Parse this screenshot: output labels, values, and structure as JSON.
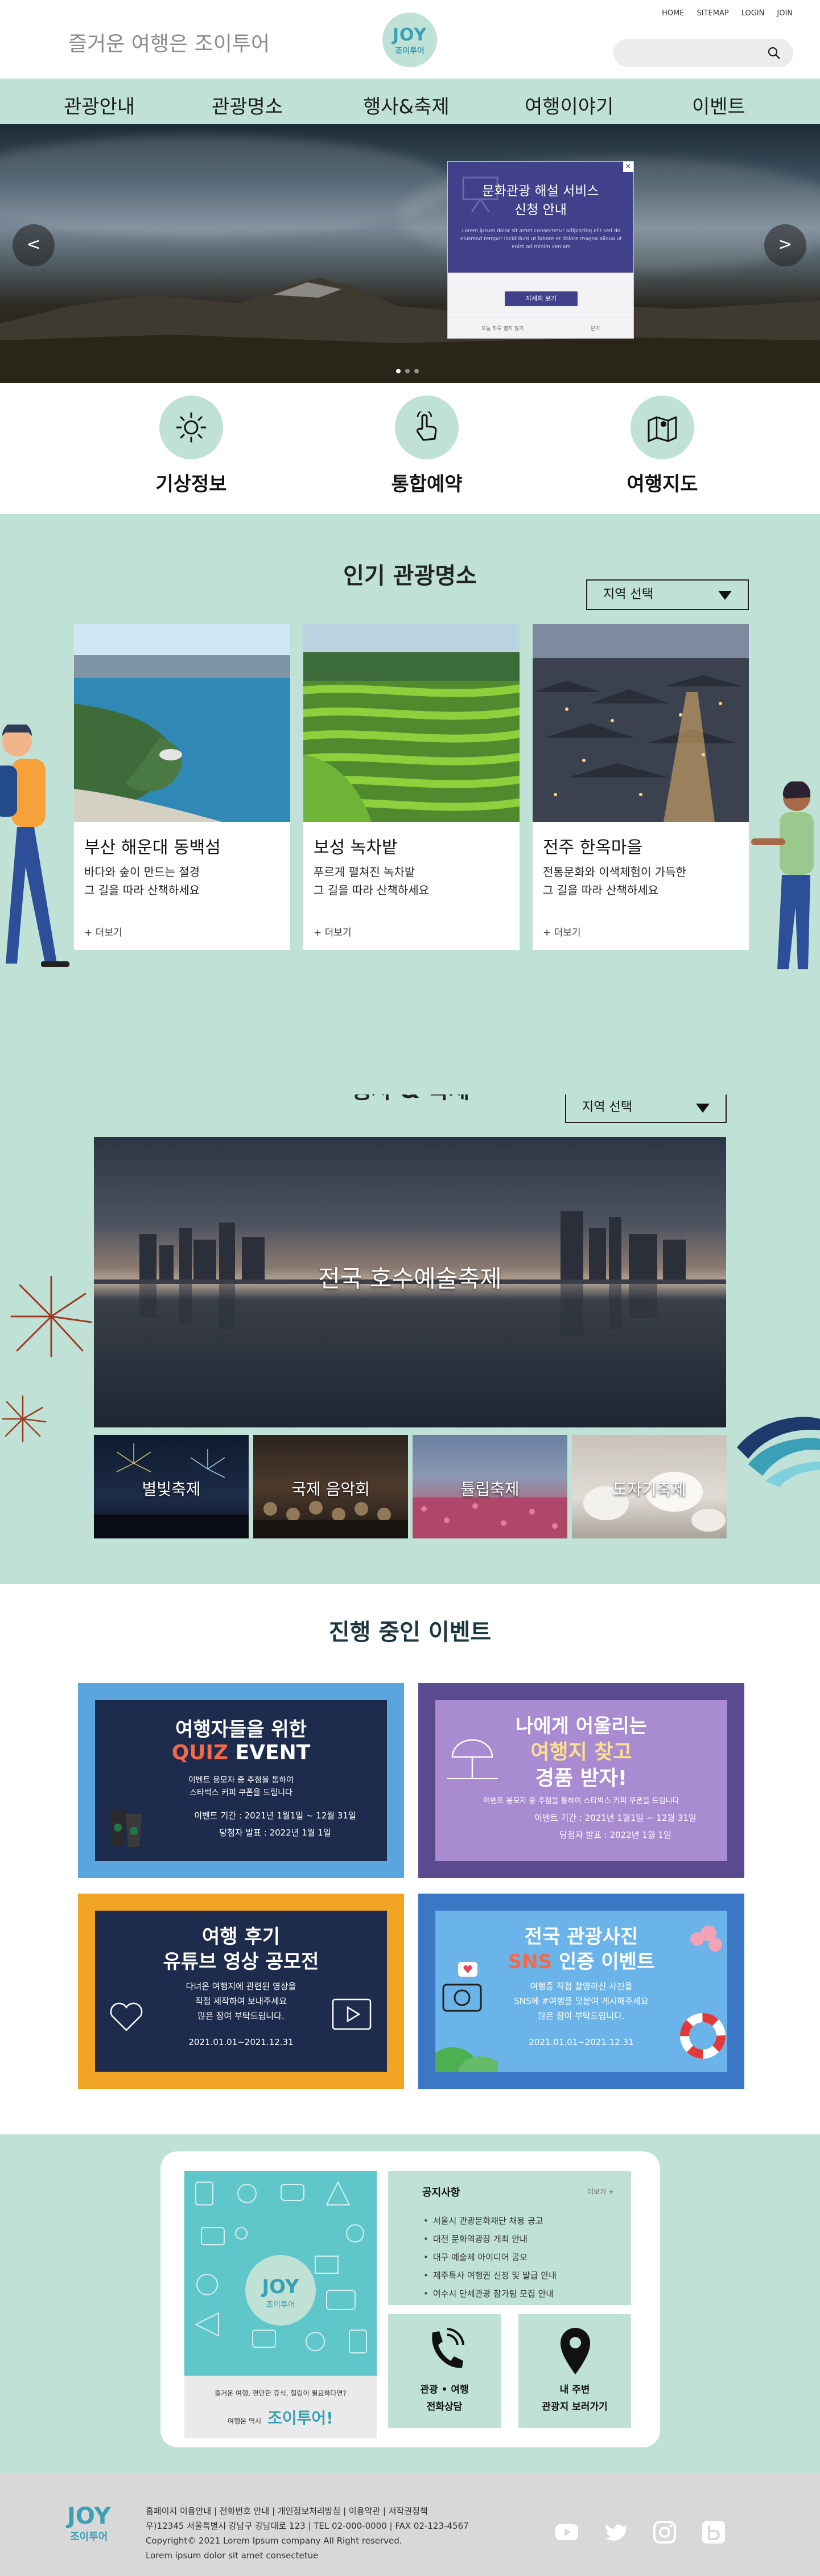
{
  "header": {
    "slogan": "즐거운 여행은 조이투어",
    "logo": {
      "word": "JOY",
      "sub": "조이투어"
    },
    "top_links": [
      "HOME",
      "SITEMAP",
      "LOGIN",
      "JOIN"
    ],
    "search_placeholder": ""
  },
  "nav": {
    "items": [
      "관광안내",
      "관광명소",
      "행사&축제",
      "여행이야기",
      "이벤트"
    ]
  },
  "hero": {
    "prev": "<",
    "next": ">",
    "popup": {
      "close": "×",
      "title_line1": "문화관광 해설 서비스",
      "title_line2": "신청 안내",
      "text": "Lorem ipsum dolor sit amet consectetur adipiscing elit sed do eiusmod tempor incididunt ut labore et dolore magna aliqua ut enim ad minim veniam",
      "button": "자세히 보기",
      "footer_left": "오늘 하루 열지 않기",
      "footer_right": "닫기"
    }
  },
  "quick": [
    {
      "label": "기상정보",
      "icon": "sun-icon"
    },
    {
      "label": "통합예약",
      "icon": "touch-hand-icon"
    },
    {
      "label": "여행지도",
      "icon": "map-pin-icon"
    }
  ],
  "attractions": {
    "title": "인기 관광명소",
    "region_select": "지역 선택",
    "cards": [
      {
        "title": "부산 해운대 동백섬",
        "desc1": "바다와 숲이 만드는 절경",
        "desc2": "그 길을 따라 산책하세요",
        "more": "+ 더보기"
      },
      {
        "title": "보성 녹차밭",
        "desc1": "푸르게 펼쳐진 녹차밭",
        "desc2": "그 길을 따라 산책하세요",
        "more": "+ 더보기"
      },
      {
        "title": "전주 한옥마을",
        "desc1": "전통문화와 이색체험이 가득한",
        "desc2": "그 길을 따라 산책하세요",
        "more": "+ 더보기"
      }
    ]
  },
  "festival": {
    "title": "행사 & 축제",
    "region_select": "지역 선택",
    "main": "전국 호수예술축제",
    "thumbs": [
      "별빛축제",
      "국제 음악회",
      "튤립축제",
      "도자기축제"
    ]
  },
  "events": {
    "title": "진행 중인 이벤트",
    "items": [
      {
        "l1": "여행자들을 위한",
        "l2a": "QUIZ",
        "l2b": " EVENT",
        "l3": "이벤트 응모자 중 추첨을 통하여",
        "l4": "스타벅스 커피 쿠폰을 드립니다",
        "l5": "이벤트 기간 : 2021년 1월1일 ~ 12월 31일",
        "l6": "당첨자 발표 : 2022년 1월 1일"
      },
      {
        "l1": "나에게 어울리는",
        "l2a": "여행지 찾고",
        "l2b": "경품 받자!",
        "l3": "이벤트 응모자 중 추첨을 통하여 스타벅스 커피 쿠폰을 드립니다",
        "l5": "이벤트 기간 : 2021년 1월1일 ~ 12월 31일",
        "l6": "당첨자 발표 : 2022년 1월 1일"
      },
      {
        "l1": "여행 후기",
        "l2a": "유튜브 영상 공모전",
        "l3": "다녀온 여행지에 관련된 영상을",
        "l4": "직접 제작하여 보내주세요",
        "l5": "많은 참여 부탁드립니다.",
        "l6": "2021.01.01~2021.12.31"
      },
      {
        "l1": "전국 관광사진",
        "l2a": "SNS",
        "l2b": " 인증 이벤트",
        "l3": "여행중 직접 촬영하신 사진을",
        "l4": "SNS에 #여행을 덧붙여 게시해주세요",
        "l5": "많은 참여 부탁드립니다.",
        "l6": "2021.01.01~2021.12.31"
      }
    ]
  },
  "info": {
    "poster": {
      "logo_word": "JOY",
      "logo_sub": "조이투어",
      "q": "즐거운 여행, 편안한 휴식, 힐링이 필요하다면?",
      "a1": "여행은 역시",
      "a2": "조이투어!"
    },
    "notice": {
      "title": "공지사항",
      "more": "더보기 +",
      "items": [
        "서울시 관광문화재단 채용 공고",
        "대전 문화역광장 개최 안내",
        "대구 예술제 아이디어 공모",
        "제주특사 여행권 신청 및 발급 안내",
        "여수시 단체관광 참가팀 모집 안내"
      ]
    },
    "tiles": [
      {
        "l1": "관광 • 여행",
        "l2": "전화상담",
        "icon": "phone-icon"
      },
      {
        "l1": "내 주변",
        "l2": "관광지 보러가기",
        "icon": "location-pin-icon"
      }
    ]
  },
  "footer": {
    "logo_word": "JOY",
    "logo_sub": "조이투어",
    "line1": "홈페이지 이용안내 | 전화번호 안내 | 개인정보처리방침 | 이용약관 | 저작권정책",
    "line2": "우)12345 서울특별시 강남구 강남대로 123 | TEL 02-000-0000 | FAX 02-123-4567",
    "line3": "Copyright© 2021 Lorem Ipsum company All Right reserved.",
    "line4": "Lorem ipsum dolor sit amet consectetue",
    "social": [
      "youtube-icon",
      "twitter-icon",
      "instagram-icon",
      "blog-icon"
    ]
  },
  "colors": {
    "mint": "#bfe1d6",
    "teal": "#3aa0b5",
    "popup": "#41408a",
    "event_blue": "#5aa5dd",
    "event_purple": "#5a4a8e",
    "event_orange": "#f2a425",
    "event_navy": "#3a78c6"
  }
}
